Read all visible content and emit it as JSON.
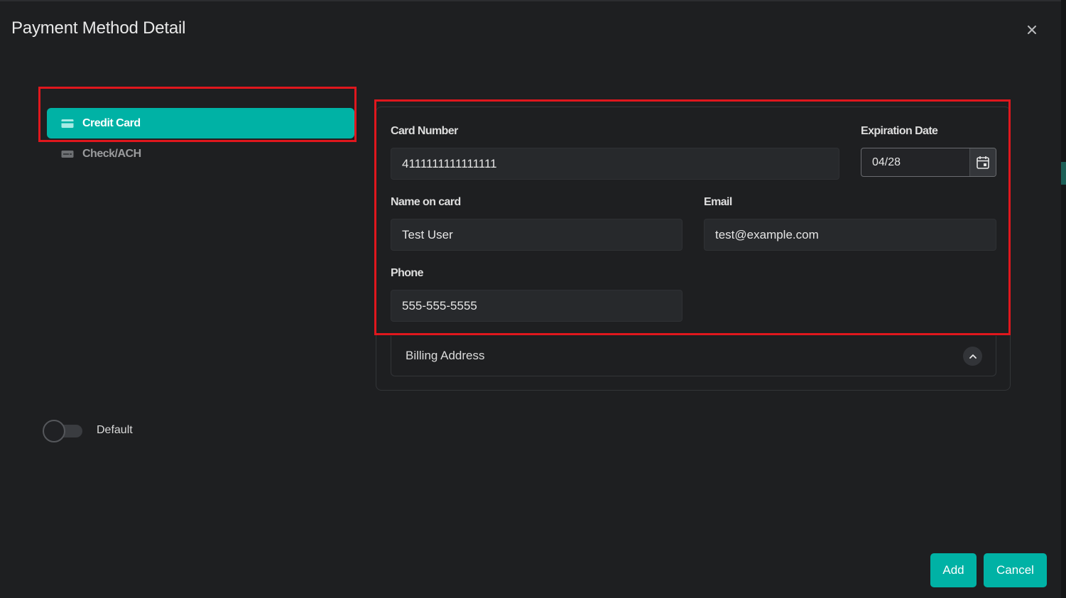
{
  "dialog": {
    "title": "Payment Method Detail",
    "close_icon": "close-icon"
  },
  "methods": [
    {
      "label": "Credit Card",
      "icon": "credit-card-icon",
      "active": true
    },
    {
      "label": "Check/ACH",
      "icon": "check-icon",
      "active": false
    }
  ],
  "form": {
    "card_number": {
      "label": "Card Number",
      "value": "4111111111111111"
    },
    "expiration": {
      "label": "Expiration Date",
      "value": "04/28",
      "icon": "calendar-icon"
    },
    "name": {
      "label": "Name on card",
      "value": "Test User"
    },
    "email": {
      "label": "Email",
      "value": "test@example.com"
    },
    "phone": {
      "label": "Phone",
      "value": "555-555-5555"
    }
  },
  "billing": {
    "label": "Billing Address",
    "icon": "chevron-up-icon"
  },
  "default_toggle": {
    "label": "Default",
    "on": false
  },
  "buttons": {
    "add": "Add",
    "cancel": "Cancel"
  },
  "colors": {
    "accent": "#00b2a5",
    "background": "#1e1f21",
    "highlight": "#e0171d"
  }
}
